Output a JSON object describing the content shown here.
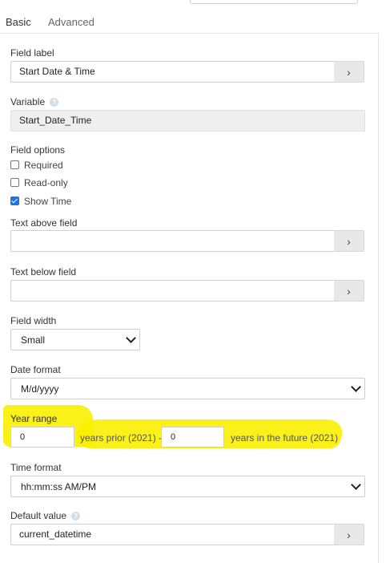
{
  "tabs": [
    {
      "label": "Basic",
      "active": true
    },
    {
      "label": "Advanced",
      "active": false
    }
  ],
  "field_label": {
    "label": "Field label",
    "value": "Start Date & Time",
    "button_icon": "chevron-right-icon"
  },
  "variable": {
    "label": "Variable",
    "help_icon": "question-icon",
    "value": "Start_Date_Time"
  },
  "field_options": {
    "label": "Field options",
    "options": [
      {
        "label": "Required",
        "checked": false
      },
      {
        "label": "Read-only",
        "checked": false
      },
      {
        "label": "Show Time",
        "checked": true
      }
    ]
  },
  "text_above": {
    "label": "Text above field",
    "value": ""
  },
  "text_below": {
    "label": "Text below field",
    "value": ""
  },
  "field_width": {
    "label": "Field width",
    "selected": "Small"
  },
  "date_format": {
    "label": "Date format",
    "selected": "M/d/yyyy"
  },
  "year_range": {
    "label": "Year range",
    "prior_value": "0",
    "prior_text": "years prior (2021) -",
    "future_value": "0",
    "future_text": "years in the future (2021)"
  },
  "time_format": {
    "label": "Time format",
    "selected": "hh:mm:ss AM/PM"
  },
  "default_value": {
    "label": "Default value",
    "help_icon": "question-icon",
    "value": "current_datetime"
  },
  "colors": {
    "accent": "#2a9d8f",
    "highlight": "#f8f000",
    "checkbox": "#1a73e8"
  }
}
